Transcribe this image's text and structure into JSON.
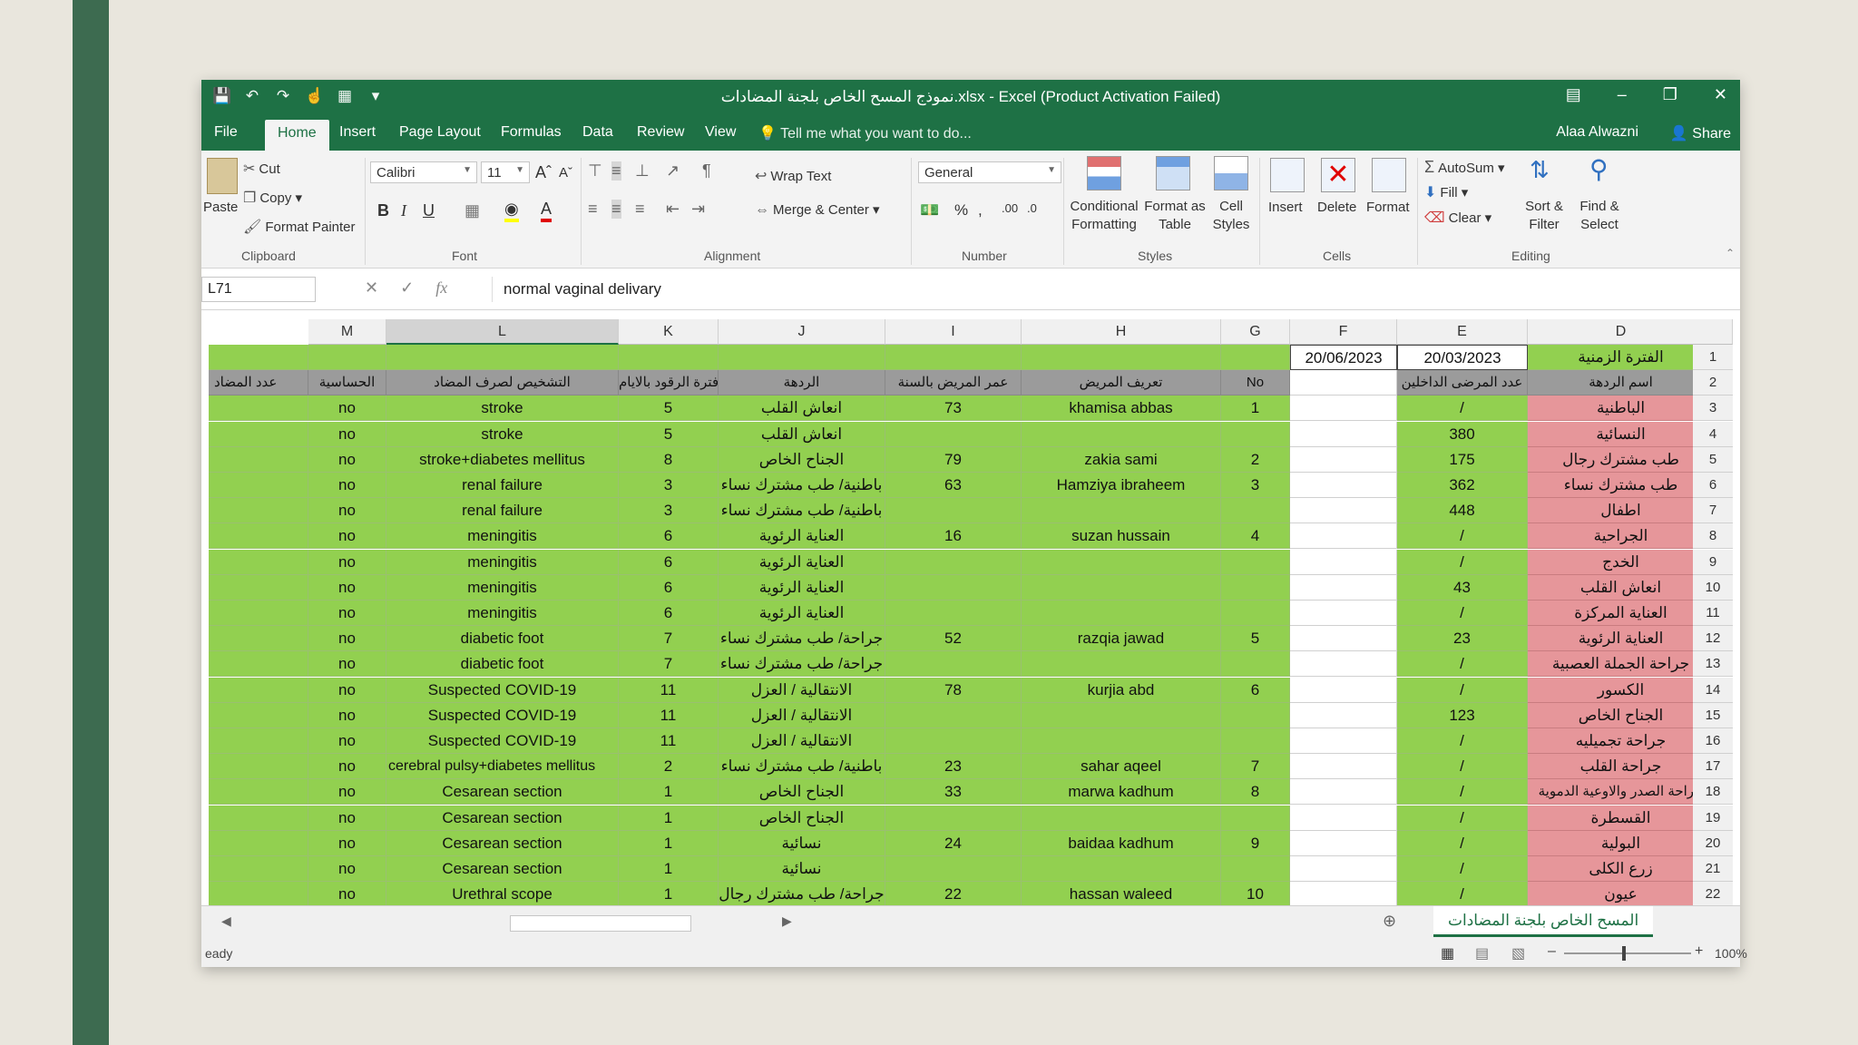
{
  "window": {
    "title": "نموذج المسح الخاص بلجنة المضادات.xlsx - Excel (Product Activation Failed)",
    "user": "Alaa Alwazni",
    "share": "Share"
  },
  "menu": {
    "tabs": [
      "File",
      "Home",
      "Insert",
      "Page Layout",
      "Formulas",
      "Data",
      "Review",
      "View"
    ],
    "tell_me": "Tell me what you want to do..."
  },
  "ribbon": {
    "clipboard": {
      "paste": "Paste",
      "cut": "Cut",
      "copy": "Copy",
      "format_painter": "Format Painter",
      "label": "Clipboard"
    },
    "font": {
      "name": "Calibri",
      "size": "11",
      "label": "Font"
    },
    "alignment": {
      "wrap": "Wrap Text",
      "merge": "Merge & Center",
      "label": "Alignment"
    },
    "number": {
      "format": "General",
      "label": "Number"
    },
    "styles": {
      "conditional": [
        "Conditional",
        "Formatting"
      ],
      "format_table": [
        "Format as",
        "Table"
      ],
      "cell_styles": [
        "Cell",
        "Styles"
      ],
      "label": "Styles"
    },
    "cells": {
      "insert": "Insert",
      "delete": "Delete",
      "format": "Format",
      "label": "Cells"
    },
    "editing": {
      "autosum": "AutoSum",
      "fill": "Fill",
      "clear": "Clear",
      "sort": [
        "Sort &",
        "Filter"
      ],
      "find": [
        "Find &",
        "Select"
      ],
      "label": "Editing"
    }
  },
  "formula_bar": {
    "name_box": "L71",
    "value": "normal vaginal delivary"
  },
  "columns": [
    "M",
    "L",
    "K",
    "J",
    "I",
    "H",
    "G",
    "F",
    "E",
    "D"
  ],
  "row1": {
    "F": "20/06/2023",
    "E": "20/03/2023",
    "D": "الفترة الزمنية"
  },
  "headers": {
    "N": "عدد المضاد",
    "M": "الحساسية",
    "L": "التشخيص لصرف المضاد",
    "K": "فترة الرقود بالايام",
    "J": "الردهة",
    "I": "عمر المريض بالسنة",
    "H": "تعريف المريض",
    "G": "No",
    "F": "",
    "E": "عدد المرضى الداخلين",
    "D": "اسم الردهة"
  },
  "rows": [
    {
      "n": "3",
      "M": "no",
      "L": "stroke",
      "K": "5",
      "J": "انعاش القلب",
      "I": "73",
      "H": "khamisa abbas",
      "G": "1",
      "E": "/",
      "D": "الباطنية"
    },
    {
      "n": "4",
      "M": "no",
      "L": "stroke",
      "K": "5",
      "J": "انعاش القلب",
      "I": "",
      "H": "",
      "G": "",
      "E": "380",
      "D": "النسائية"
    },
    {
      "n": "5",
      "M": "no",
      "L": "stroke+diabetes mellitus",
      "K": "8",
      "J": "الجناح الخاص",
      "I": "79",
      "H": "zakia sami",
      "G": "2",
      "E": "175",
      "D": "طب مشترك رجال"
    },
    {
      "n": "6",
      "M": "no",
      "L": "renal failure",
      "K": "3",
      "J": "باطنية/ طب مشترك نساء",
      "I": "63",
      "H": "Hamziya ibraheem",
      "G": "3",
      "E": "362",
      "D": "طب مشترك نساء"
    },
    {
      "n": "7",
      "M": "no",
      "L": "renal failure",
      "K": "3",
      "J": "باطنية/ طب مشترك نساء",
      "I": "",
      "H": "",
      "G": "",
      "E": "448",
      "D": "اطفال"
    },
    {
      "n": "8",
      "M": "no",
      "L": "meningitis",
      "K": "6",
      "J": "العناية الرئوية",
      "I": "16",
      "H": "suzan hussain",
      "G": "4",
      "E": "/",
      "D": "الجراحية"
    },
    {
      "n": "9",
      "M": "no",
      "L": "meningitis",
      "K": "6",
      "J": "العناية الرئوية",
      "I": "",
      "H": "",
      "G": "",
      "E": "/",
      "D": "الخدج"
    },
    {
      "n": "10",
      "M": "no",
      "L": "meningitis",
      "K": "6",
      "J": "العناية الرئوية",
      "I": "",
      "H": "",
      "G": "",
      "E": "43",
      "D": "انعاش القلب"
    },
    {
      "n": "11",
      "M": "no",
      "L": "meningitis",
      "K": "6",
      "J": "العناية الرئوية",
      "I": "",
      "H": "",
      "G": "",
      "E": "/",
      "D": "العناية المركزة"
    },
    {
      "n": "12",
      "M": "no",
      "L": "diabetic foot",
      "K": "7",
      "J": "جراحة/ طب مشترك نساء",
      "I": "52",
      "H": "razqia jawad",
      "G": "5",
      "E": "23",
      "D": "العناية الرئوية"
    },
    {
      "n": "13",
      "M": "no",
      "L": "diabetic foot",
      "K": "7",
      "J": "جراحة/ طب مشترك نساء",
      "I": "",
      "H": "",
      "G": "",
      "E": "/",
      "D": "جراحة الجملة العصبية"
    },
    {
      "n": "14",
      "M": "no",
      "L": "Suspected COVID-19",
      "K": "11",
      "J": "الانتقالية / العزل",
      "I": "78",
      "H": "kurjia abd",
      "G": "6",
      "E": "/",
      "D": "الكسور"
    },
    {
      "n": "15",
      "M": "no",
      "L": "Suspected COVID-19",
      "K": "11",
      "J": "الانتقالية / العزل",
      "I": "",
      "H": "",
      "G": "",
      "E": "123",
      "D": "الجناح الخاص"
    },
    {
      "n": "16",
      "M": "no",
      "L": "Suspected COVID-19",
      "K": "11",
      "J": "الانتقالية / العزل",
      "I": "",
      "H": "",
      "G": "",
      "E": "/",
      "D": "جراحة تجميليه"
    },
    {
      "n": "17",
      "M": "no",
      "L": "cerebral pulsy+diabetes mellitus",
      "K": "2",
      "J": "باطنية/ طب مشترك نساء",
      "I": "23",
      "H": "sahar aqeel",
      "G": "7",
      "E": "/",
      "D": "جراحة القلب"
    },
    {
      "n": "18",
      "M": "no",
      "L": "Cesarean section",
      "K": "1",
      "J": "الجناح الخاص",
      "I": "33",
      "H": "marwa kadhum",
      "G": "8",
      "E": "/",
      "D": "جراحة الصدر والاوعية الدموية"
    },
    {
      "n": "19",
      "M": "no",
      "L": "Cesarean section",
      "K": "1",
      "J": "الجناح الخاص",
      "I": "",
      "H": "",
      "G": "",
      "E": "/",
      "D": "القسطرة"
    },
    {
      "n": "20",
      "M": "no",
      "L": "Cesarean section",
      "K": "1",
      "J": "نسائية",
      "I": "24",
      "H": "baidaa kadhum",
      "G": "9",
      "E": "/",
      "D": "البولية"
    },
    {
      "n": "21",
      "M": "no",
      "L": "Cesarean section",
      "K": "1",
      "J": "نسائية",
      "I": "",
      "H": "",
      "G": "",
      "E": "/",
      "D": "زرع الكلى"
    },
    {
      "n": "22",
      "M": "no",
      "L": "Urethral scope",
      "K": "1",
      "J": "جراحة/ طب مشترك رجال",
      "I": "22",
      "H": "hassan waleed",
      "G": "10",
      "E": "/",
      "D": "عيون"
    }
  ],
  "sheet_tab": "المسح الخاص بلجنة المضادات",
  "status": {
    "ready": "eady",
    "zoom": "100%"
  },
  "colors": {
    "excel_green": "#1e7145",
    "cell_green": "#92d050",
    "cell_red": "#e6969a",
    "header_gray": "#9b9b9b"
  }
}
